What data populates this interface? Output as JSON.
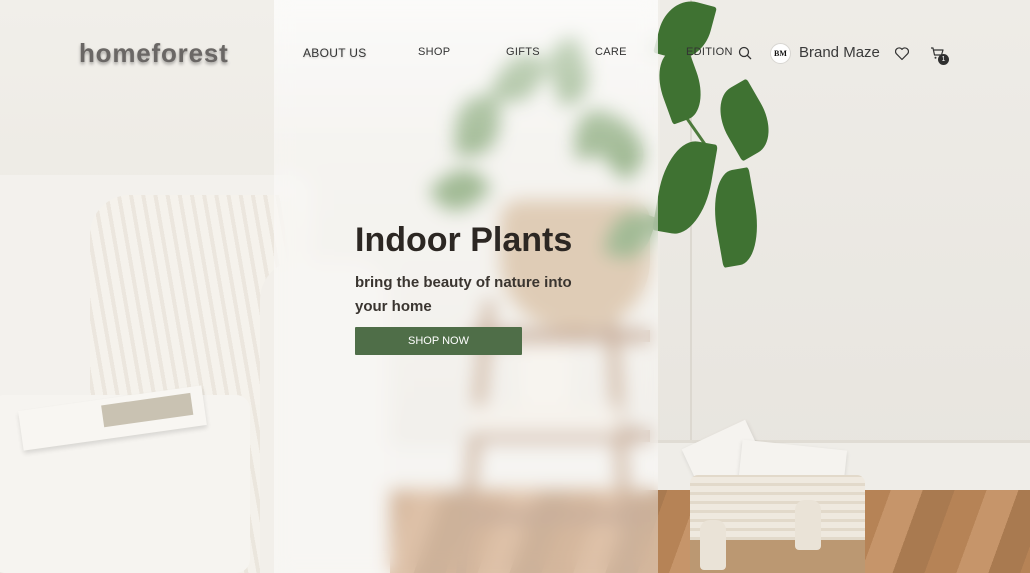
{
  "header": {
    "logo": "homeforest",
    "nav": [
      {
        "label": "ABOUT US",
        "active": true
      },
      {
        "label": "SHOP"
      },
      {
        "label": "GIFTS"
      },
      {
        "label": "CARE"
      },
      {
        "label": "EDITION"
      }
    ],
    "brand": {
      "initials": "BM",
      "name": "Brand Maze"
    },
    "cart_count": "1",
    "icons": [
      "search-icon",
      "heart-icon",
      "cart-icon"
    ]
  },
  "hero": {
    "title": "Indoor Plants",
    "subtitle": "bring the beauty of nature into your home",
    "button_label": "SHOP NOW"
  },
  "colors": {
    "accent": "#4f6e48",
    "text_dark": "#2c2723",
    "logo": "#6a6765"
  }
}
